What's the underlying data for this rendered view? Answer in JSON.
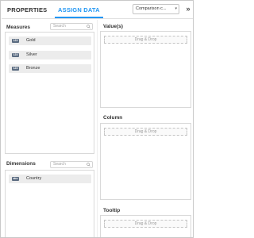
{
  "tabs": {
    "properties": "PROPERTIES",
    "assign_data": "ASSIGN DATA"
  },
  "chart_select": {
    "value": "Comparison c...",
    "caret": "▾"
  },
  "collapse_glyph": "»",
  "measures": {
    "title": "Measures",
    "search_placeholder": "Search",
    "items": [
      {
        "badge": "123",
        "label": "Gold"
      },
      {
        "badge": "123",
        "label": "Silver"
      },
      {
        "badge": "123",
        "label": "Bronze"
      }
    ]
  },
  "dimensions": {
    "title": "Dimensions",
    "search_placeholder": "Search",
    "items": [
      {
        "badge": "abc",
        "label": "Country"
      }
    ]
  },
  "drop_sections": {
    "values": {
      "title": "Value(s)",
      "placeholder": "Drag & Drop"
    },
    "column": {
      "title": "Column",
      "placeholder": "Drag & Drop"
    },
    "tooltip": {
      "title": "Tooltip",
      "placeholder": "Drag & Drop"
    }
  },
  "icons": {
    "search": "search-icon",
    "badge_color": "#5a6b80",
    "accent": "#2196f3"
  }
}
